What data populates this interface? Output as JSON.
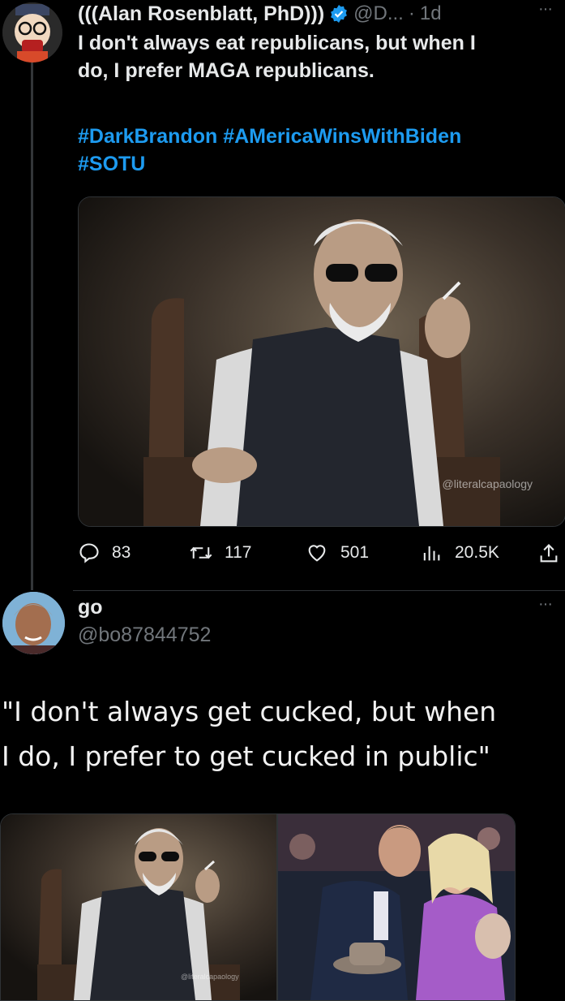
{
  "tweet1": {
    "author_name": "(((Alan Rosenblatt, PhD)))",
    "handle": "@D...",
    "separator": "·",
    "time": "1d",
    "more": "···",
    "text_line1": "I don't always eat republicans, but when I",
    "text_line2": "do, I prefer MAGA republicans.",
    "hashtags_line1": "#DarkBrandon #AMericaWinsWithBiden",
    "hashtags_line2": "#SOTU",
    "image_watermark": "@literalcapaology",
    "actions": {
      "replies": "83",
      "retweets": "117",
      "likes": "501",
      "views": "20.5K"
    }
  },
  "tweet2": {
    "author_name": "go",
    "handle": "@bo87844752",
    "more": "···",
    "text_line1": "\"I don't always get cucked, but when",
    "text_line2": "I do, I prefer to get cucked in public\"",
    "image_watermark": "@literalcapaology"
  },
  "colors": {
    "link": "#1d9bf0",
    "verified": "#1d9bf0",
    "text": "#e7e9ea",
    "muted": "#71767b"
  }
}
